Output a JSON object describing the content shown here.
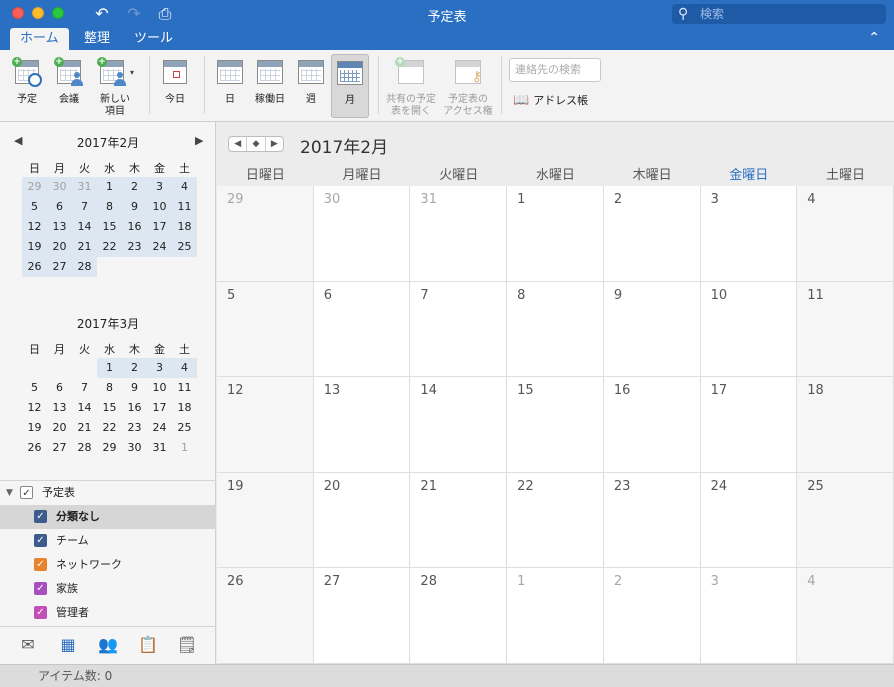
{
  "window": {
    "title": "予定表"
  },
  "titlebar": {
    "search_placeholder": "検索"
  },
  "tabs": [
    {
      "label": "ホーム",
      "active": true
    },
    {
      "label": "整理",
      "active": false
    },
    {
      "label": "ツール",
      "active": false
    }
  ],
  "ribbon": {
    "appointment": "予定",
    "meeting": "会議",
    "new_item_1": "新しい",
    "new_item_2": "項目",
    "today": "今日",
    "day": "日",
    "work_week": "稼働日",
    "week": "週",
    "month": "月",
    "open_shared_1": "共有の予定",
    "open_shared_2": "表を開く",
    "permissions_1": "予定表の",
    "permissions_2": "アクセス権",
    "contact_search_placeholder": "連絡先の検索",
    "address_book": "アドレス帳"
  },
  "mini_calendars": [
    {
      "title": "2017年2月",
      "dow": [
        "日",
        "月",
        "火",
        "水",
        "木",
        "金",
        "土"
      ],
      "weeks": [
        [
          {
            "d": "29",
            "o": true
          },
          {
            "d": "30",
            "o": true
          },
          {
            "d": "31",
            "o": true
          },
          {
            "d": "1"
          },
          {
            "d": "2"
          },
          {
            "d": "3"
          },
          {
            "d": "4"
          }
        ],
        [
          {
            "d": "5"
          },
          {
            "d": "6"
          },
          {
            "d": "7"
          },
          {
            "d": "8"
          },
          {
            "d": "9"
          },
          {
            "d": "10"
          },
          {
            "d": "11"
          }
        ],
        [
          {
            "d": "12"
          },
          {
            "d": "13"
          },
          {
            "d": "14"
          },
          {
            "d": "15"
          },
          {
            "d": "16"
          },
          {
            "d": "17"
          },
          {
            "d": "18"
          }
        ],
        [
          {
            "d": "19"
          },
          {
            "d": "20"
          },
          {
            "d": "21"
          },
          {
            "d": "22"
          },
          {
            "d": "23"
          },
          {
            "d": "24"
          },
          {
            "d": "25"
          }
        ],
        [
          {
            "d": "26"
          },
          {
            "d": "27"
          },
          {
            "d": "28"
          }
        ]
      ]
    },
    {
      "title": "2017年3月",
      "dow": [
        "日",
        "月",
        "火",
        "水",
        "木",
        "金",
        "土"
      ],
      "weeks": [
        [
          {
            "d": ""
          },
          {
            "d": ""
          },
          {
            "d": ""
          },
          {
            "d": "1",
            "h": true
          },
          {
            "d": "2",
            "h": true
          },
          {
            "d": "3",
            "h": true
          },
          {
            "d": "4",
            "h": true
          }
        ],
        [
          {
            "d": "5"
          },
          {
            "d": "6"
          },
          {
            "d": "7"
          },
          {
            "d": "8"
          },
          {
            "d": "9"
          },
          {
            "d": "10"
          },
          {
            "d": "11"
          }
        ],
        [
          {
            "d": "12"
          },
          {
            "d": "13"
          },
          {
            "d": "14"
          },
          {
            "d": "15"
          },
          {
            "d": "16"
          },
          {
            "d": "17"
          },
          {
            "d": "18"
          }
        ],
        [
          {
            "d": "19"
          },
          {
            "d": "20"
          },
          {
            "d": "21"
          },
          {
            "d": "22"
          },
          {
            "d": "23"
          },
          {
            "d": "24"
          },
          {
            "d": "25"
          }
        ],
        [
          {
            "d": "26"
          },
          {
            "d": "27"
          },
          {
            "d": "28"
          },
          {
            "d": "29"
          },
          {
            "d": "30"
          },
          {
            "d": "31"
          },
          {
            "d": "1",
            "o": true
          }
        ]
      ]
    }
  ],
  "calendars": {
    "group_label": "予定表",
    "items": [
      {
        "label": "分類なし",
        "color": "#3d5c8c",
        "selected": true
      },
      {
        "label": "チーム",
        "color": "#3d5c8c",
        "selected": false
      },
      {
        "label": "ネットワーク",
        "color": "#e8822c",
        "selected": false
      },
      {
        "label": "家族",
        "color": "#a84fc0",
        "selected": false
      },
      {
        "label": "管理者",
        "color": "#c24fb8",
        "selected": false
      }
    ]
  },
  "main": {
    "month_title": "2017年2月",
    "weekdays": [
      "日曜日",
      "月曜日",
      "火曜日",
      "水曜日",
      "木曜日",
      "金曜日",
      "土曜日"
    ],
    "current_weekday_index": 5,
    "weeks": [
      [
        {
          "d": "29",
          "o": true
        },
        {
          "d": "30",
          "o": true
        },
        {
          "d": "31",
          "o": true
        },
        {
          "d": "1"
        },
        {
          "d": "2"
        },
        {
          "d": "3"
        },
        {
          "d": "4"
        }
      ],
      [
        {
          "d": "5"
        },
        {
          "d": "6"
        },
        {
          "d": "7"
        },
        {
          "d": "8"
        },
        {
          "d": "9"
        },
        {
          "d": "10"
        },
        {
          "d": "11"
        }
      ],
      [
        {
          "d": "12"
        },
        {
          "d": "13"
        },
        {
          "d": "14"
        },
        {
          "d": "15"
        },
        {
          "d": "16"
        },
        {
          "d": "17"
        },
        {
          "d": "18"
        }
      ],
      [
        {
          "d": "19"
        },
        {
          "d": "20"
        },
        {
          "d": "21"
        },
        {
          "d": "22"
        },
        {
          "d": "23"
        },
        {
          "d": "24"
        },
        {
          "d": "25"
        }
      ],
      [
        {
          "d": "26"
        },
        {
          "d": "27"
        },
        {
          "d": "28"
        },
        {
          "d": "1",
          "o": true
        },
        {
          "d": "2",
          "o": true
        },
        {
          "d": "3",
          "o": true
        },
        {
          "d": "4",
          "o": true
        }
      ]
    ]
  },
  "statusbar": {
    "text": "アイテム数: 0"
  }
}
